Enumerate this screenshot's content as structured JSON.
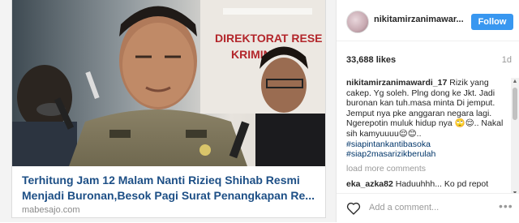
{
  "media": {
    "wall_sign_line1": "DIREKTORAT RESE",
    "wall_sign_line2": "KRIMIN",
    "headline": "Terhitung Jam 12 Malam Nanti Rizieq Shihab Resmi\nMenjadi Buronan,Besok Pagi Surat Penangkapan Re...",
    "source": "mabesajo.com"
  },
  "header": {
    "username": "nikitamirzanimawar...",
    "follow_label": "Follow"
  },
  "stats": {
    "likes": "33,688 likes",
    "age": "1d"
  },
  "comments": {
    "caption_user": "nikitamirzanimawardi_17",
    "caption_text": " Rizik yang cakep. Yg soleh. Plng dong ke Jkt. Jadi buronan kan tuh.masa minta Di jemput. Jemput nya pke anggaran negara lagi. Ngerepotin muluk hidup nya 🙄😌.. Nakal sih kamyuuuu😌😊..",
    "tags": [
      "#siapintankantibasoka",
      "#siap2masarizikberulah"
    ],
    "load_more": "load more comments",
    "second_user": "eka_azka82",
    "second_text": " Haduuhhh... Ko pd repot"
  },
  "add_comment": {
    "placeholder": "Add a comment...",
    "more": "•••"
  }
}
